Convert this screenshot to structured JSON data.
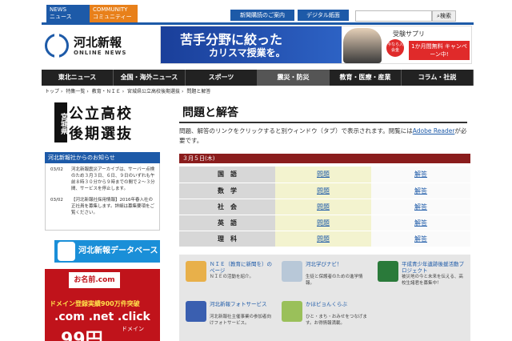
{
  "top": {
    "news_tab": [
      "NEWS",
      "ニュース"
    ],
    "community_tab": [
      "COMMUNITY",
      "コミュニティー"
    ],
    "buttons": [
      "新聞購読のご案内",
      "デジタル紙面"
    ],
    "search_placeholder": "",
    "search_button": "検索"
  },
  "logo": {
    "name": "河北新報",
    "sub": "ONLINE NEWS"
  },
  "banner": {
    "line1": "苦手分野に絞った",
    "line2": "カリスマ授業を。",
    "brand": "受験サプリ",
    "badge": "今なら入会金",
    "cta": "1か月間無料 キャンペーン中!"
  },
  "nav": [
    "東北ニュース",
    "全国・海外ニュース",
    "スポーツ",
    "震災・防災",
    "教育・医療・産業",
    "コラム・社説"
  ],
  "breadcrumb": [
    "トップ",
    "特集一覧",
    "教育・ＮＩＥ",
    "宮城県公立高校後期選抜",
    "問題と解答"
  ],
  "sidebar": {
    "ken_vertical": "宮城県",
    "ken_row1": "公立高校",
    "ken_row2": "後期選抜",
    "notice_head": "河北新報社からのお知らせ",
    "notices": [
      {
        "date": "03/02",
        "text": "河北新報震災アーカイブは、サーバー点検のため３月３日、６日、９日のいずれも午前８時３０分から９時までの間で２～３分間、サービスを停止します。"
      },
      {
        "date": "03/02",
        "text": "【河北新報社採用情報】2016年春入社の正社員を募集します。詳細は募集要項をご覧ください。"
      }
    ],
    "db_banner": "河北新報データベース",
    "ad_logo": "お名前.com",
    "ad_line1": "ドメイン登録実績900万件突破",
    "ad_line2": ".com .net .click",
    "ad_line3": "ドメイン",
    "ad_line4": "99円"
  },
  "main": {
    "title": "問題と解答",
    "desc_before": "問題、解答のリンクをクリックすると別ウィンドウ（タブ）で表示されます。閲覧には",
    "desc_link": "Adobe Reader",
    "desc_after": "が必要です。",
    "date": "３月５日(木)",
    "rows": [
      {
        "subject": "国　語",
        "q": "問題",
        "a": "解答"
      },
      {
        "subject": "数　学",
        "q": "問題",
        "a": "解答"
      },
      {
        "subject": "社　会",
        "q": "問題",
        "a": "解答"
      },
      {
        "subject": "英　語",
        "q": "問題",
        "a": "解答"
      },
      {
        "subject": "理　科",
        "q": "問題",
        "a": "解答"
      }
    ]
  },
  "tiles": [
    {
      "title": "ＮＩＥ（教育に新聞を）のページ",
      "desc": "ＮＩＥの活動を紹介。",
      "color": "#e8b04a"
    },
    {
      "title": "河北学びナビ！",
      "desc": "生徒と保護者のための進学情報。",
      "color": "#b8c8d8"
    },
    {
      "title": "平成青少年遺跡後援活動プロジェクト",
      "desc": "被災地の今と未来を伝える、高校生諸君を募集中！",
      "color": "#2a7a3a"
    },
    {
      "title": "河北新報フォトサービス",
      "desc": "河北新報社主催事業の参加者向けフォトサービス。",
      "color": "#3a5fb0"
    },
    {
      "title": "かほピョんくらぶ",
      "desc": "ひと・まち・おみせをつなげます。お得情報満載。",
      "color": "#9ac05a"
    }
  ]
}
